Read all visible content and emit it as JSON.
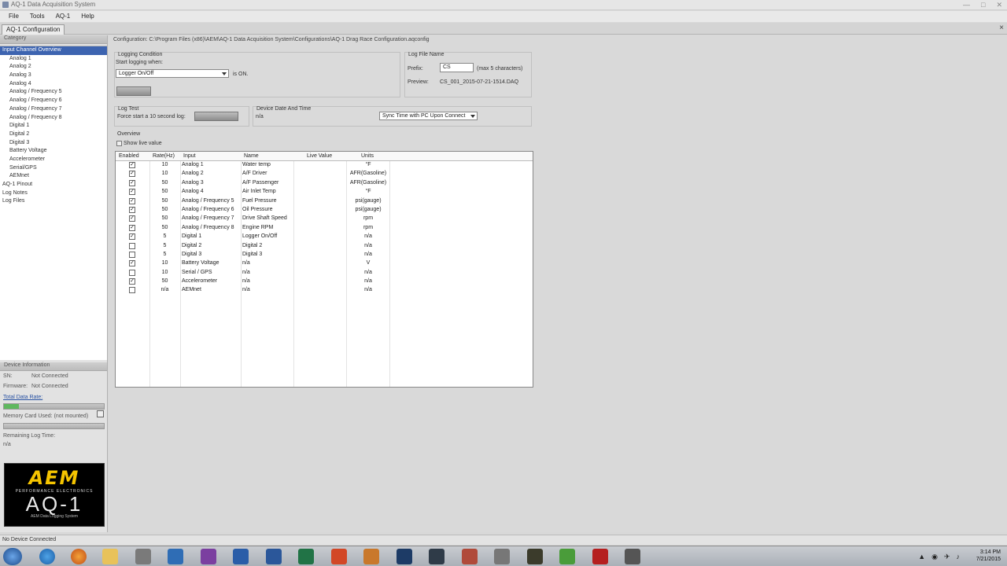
{
  "window": {
    "title": "AQ-1 Data Acquisition System",
    "controls": [
      "—",
      "□",
      "✕"
    ]
  },
  "menu": [
    "File",
    "Tools",
    "AQ-1",
    "Help"
  ],
  "tab": {
    "label": "AQ-1 Configuration",
    "close": "×"
  },
  "category": {
    "header": "Category",
    "items": [
      {
        "label": "Input Channel Overview",
        "level": 1,
        "selected": true
      },
      {
        "label": "Analog 1",
        "level": 2
      },
      {
        "label": "Analog 2",
        "level": 2
      },
      {
        "label": "Analog 3",
        "level": 2
      },
      {
        "label": "Analog 4",
        "level": 2
      },
      {
        "label": "Analog / Frequency 5",
        "level": 2
      },
      {
        "label": "Analog / Frequency 6",
        "level": 2
      },
      {
        "label": "Analog / Frequency 7",
        "level": 2
      },
      {
        "label": "Analog / Frequency 8",
        "level": 2
      },
      {
        "label": "Digital 1",
        "level": 2
      },
      {
        "label": "Digital 2",
        "level": 2
      },
      {
        "label": "Digital 3",
        "level": 2
      },
      {
        "label": "Battery Voltage",
        "level": 2
      },
      {
        "label": "Accelerometer",
        "level": 2
      },
      {
        "label": "Serial/GPS",
        "level": 2
      },
      {
        "label": "AEMnet",
        "level": 2
      },
      {
        "label": "AQ-1 Pinout",
        "level": 1
      },
      {
        "label": "Log Notes",
        "level": 1
      },
      {
        "label": "Log Files",
        "level": 1
      }
    ]
  },
  "device": {
    "header": "Device Information",
    "sn_label": "SN:",
    "sn_value": "Not Connected",
    "fw_label": "Firmware:",
    "fw_value": "Not Connected",
    "rate_link": "Total Data Rate:",
    "rate_fill": 0.15,
    "memory_label": "Memory Card Used: (not mounted)",
    "remaining_label": "Remaining Log Time:",
    "remaining_value": "n/a"
  },
  "logo": {
    "brand": "AEM",
    "tagline": "PERFORMANCE ELECTRONICS",
    "product": "AQ-1",
    "subtitle": "AEM Data Logging System"
  },
  "config_path": "Configuration: C:\\Program Files (x86)\\AEM\\AQ-1 Data Acquisition System\\Configurations\\AQ-1 Drag Race Configuration.aqconfig",
  "logging": {
    "group": "Logging Condition",
    "start_label": "Start logging when:",
    "condition": "Logger On/Off",
    "is_on": "is ON."
  },
  "logfile": {
    "group": "Log File Name",
    "prefix_label": "Prefix:",
    "prefix_value": "CS",
    "max_note": "(max 5 characters)",
    "preview_label": "Preview:",
    "preview_value": "CS_001_2015-07-21-1514.DAQ"
  },
  "logtest": {
    "group": "Log Test",
    "label": "Force start a 10 second log:"
  },
  "devtime": {
    "group": "Device Date And Time",
    "value": "n/a",
    "sync": "Sync Time with PC Upon Connect"
  },
  "overview": {
    "group": "Overview",
    "show_live": "Show live value",
    "columns": [
      "Enabled",
      "Rate(Hz)",
      "Input",
      "Name",
      "Live Value",
      "Units"
    ],
    "rows": [
      {
        "enabled": true,
        "rate": "10",
        "input": "Analog 1",
        "name": "Water temp",
        "live": "",
        "units": "°F"
      },
      {
        "enabled": true,
        "rate": "10",
        "input": "Analog 2",
        "name": "A/F Driver",
        "live": "",
        "units": "AFR(Gasoline)"
      },
      {
        "enabled": true,
        "rate": "50",
        "input": "Analog 3",
        "name": "A/F Passenger",
        "live": "",
        "units": "AFR(Gasoline)"
      },
      {
        "enabled": true,
        "rate": "50",
        "input": "Analog 4",
        "name": "Air Inlet Temp",
        "live": "",
        "units": "°F"
      },
      {
        "enabled": true,
        "rate": "50",
        "input": "Analog / Frequency 5",
        "name": "Fuel Pressure",
        "live": "",
        "units": "psi(gauge)"
      },
      {
        "enabled": true,
        "rate": "50",
        "input": "Analog / Frequency 6",
        "name": "Oil Pressure",
        "live": "",
        "units": "psi(gauge)"
      },
      {
        "enabled": true,
        "rate": "50",
        "input": "Analog / Frequency 7",
        "name": "Drive Shaft Speed",
        "live": "",
        "units": "rpm"
      },
      {
        "enabled": true,
        "rate": "50",
        "input": "Analog / Frequency 8",
        "name": "Engine RPM",
        "live": "",
        "units": "rpm"
      },
      {
        "enabled": true,
        "rate": "5",
        "input": "Digital 1",
        "name": "Logger On/Off",
        "live": "",
        "units": "n/a"
      },
      {
        "enabled": false,
        "rate": "5",
        "input": "Digital 2",
        "name": "Digital 2",
        "live": "",
        "units": "n/a"
      },
      {
        "enabled": false,
        "rate": "5",
        "input": "Digital 3",
        "name": "Digital 3",
        "live": "",
        "units": "n/a"
      },
      {
        "enabled": true,
        "rate": "10",
        "input": "Battery Voltage",
        "name": "n/a",
        "live": "",
        "units": "V"
      },
      {
        "enabled": false,
        "rate": "10",
        "input": "Serial / GPS",
        "name": "n/a",
        "live": "",
        "units": "n/a"
      },
      {
        "enabled": true,
        "rate": "50",
        "input": "Accelerometer",
        "name": "n/a",
        "live": "",
        "units": "n/a"
      },
      {
        "enabled": false,
        "rate": "n/a",
        "input": "AEMnet",
        "name": "n/a",
        "live": "",
        "units": "n/a"
      }
    ]
  },
  "status": "No Device Connected",
  "taskbar": {
    "apps": [
      {
        "icon": "folder-icon",
        "color": "#e8c25a"
      },
      {
        "icon": "media-player-icon",
        "color": "#7a7a7a"
      },
      {
        "icon": "app-n-icon",
        "color": "#2f6db5"
      },
      {
        "icon": "onenote-icon",
        "color": "#7b3fa0"
      },
      {
        "icon": "app-s-icon",
        "color": "#2a5da8"
      },
      {
        "icon": "word-icon",
        "color": "#2b579a"
      },
      {
        "icon": "excel-icon",
        "color": "#217346"
      },
      {
        "icon": "powerpoint-icon",
        "color": "#d24726"
      },
      {
        "icon": "app-stack-icon",
        "color": "#c9782b"
      },
      {
        "icon": "photoshop-icon",
        "color": "#1d3b66"
      },
      {
        "icon": "lightroom-icon",
        "color": "#2f3b48"
      },
      {
        "icon": "app-grid-icon",
        "color": "#b04a3a"
      },
      {
        "icon": "aq1-app-icon",
        "color": "#777777"
      },
      {
        "icon": "scope-icon",
        "color": "#3b3b2b"
      },
      {
        "icon": "play-icon",
        "color": "#4a9c3a"
      },
      {
        "icon": "acrobat-icon",
        "color": "#b51f1f"
      },
      {
        "icon": "app-oi-icon",
        "color": "#555555"
      }
    ],
    "time": "3:14 PM",
    "date": "7/21/2015"
  }
}
